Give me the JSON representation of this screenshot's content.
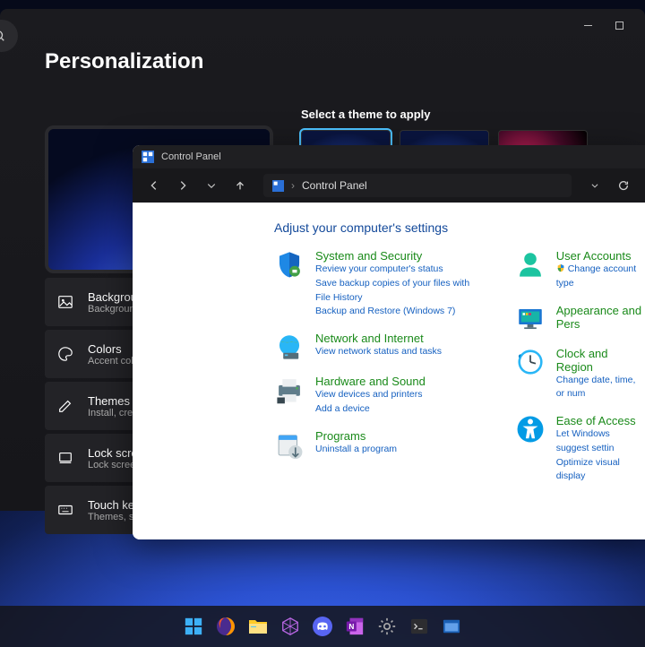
{
  "settings": {
    "title": "Personalization",
    "theme_label": "Select a theme to apply",
    "items": [
      {
        "icon": "image-icon",
        "title": "Background",
        "sub": "Background i"
      },
      {
        "icon": "palette-icon",
        "title": "Colors",
        "sub": "Accent color,"
      },
      {
        "icon": "pencil-icon",
        "title": "Themes",
        "sub": "Install, create"
      },
      {
        "icon": "lock-icon",
        "title": "Lock screen",
        "sub": "Lock screen i"
      },
      {
        "icon": "keyboard-icon",
        "title": "Touch keyb",
        "sub": "Themes, size"
      }
    ]
  },
  "cp": {
    "window_title": "Control Panel",
    "breadcrumb": "Control Panel",
    "heading": "Adjust your computer's settings",
    "left": [
      {
        "icon": "shield",
        "title": "System and Security",
        "links": [
          "Review your computer's status",
          "Save backup copies of your files with File History",
          "Backup and Restore (Windows 7)"
        ]
      },
      {
        "icon": "globe",
        "title": "Network and Internet",
        "links": [
          "View network status and tasks"
        ]
      },
      {
        "icon": "printer",
        "title": "Hardware and Sound",
        "links": [
          "View devices and printers",
          "Add a device"
        ]
      },
      {
        "icon": "box",
        "title": "Programs",
        "links": [
          "Uninstall a program"
        ]
      }
    ],
    "right": [
      {
        "icon": "user",
        "title": "User Accounts",
        "links": [
          "Change account type"
        ],
        "shield": true
      },
      {
        "icon": "monitor",
        "title": "Appearance and Pers",
        "links": []
      },
      {
        "icon": "clock",
        "title": "Clock and Region",
        "links": [
          "Change date, time, or num"
        ]
      },
      {
        "icon": "access",
        "title": "Ease of Access",
        "links": [
          "Let Windows suggest settin",
          "Optimize visual display"
        ]
      }
    ]
  },
  "taskbar": [
    "start",
    "firefox",
    "explorer",
    "store",
    "discord",
    "onenote",
    "settings",
    "terminal",
    "app"
  ]
}
